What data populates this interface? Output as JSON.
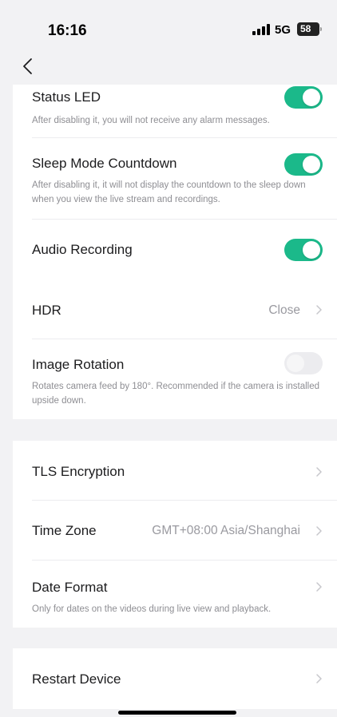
{
  "status_bar": {
    "time": "16:16",
    "network": "5G",
    "battery": "58"
  },
  "settings": {
    "status_led": {
      "title": "Status LED",
      "description": "After disabling it, you will not receive any alarm messages.",
      "enabled": true
    },
    "sleep_mode_countdown": {
      "title": "Sleep Mode Countdown",
      "description": "After disabling it, it will not display the countdown to the sleep down when you view the live stream and recordings.",
      "enabled": true
    },
    "audio_recording": {
      "title": "Audio Recording",
      "enabled": true
    },
    "hdr": {
      "title": "HDR",
      "value": "Close"
    },
    "image_rotation": {
      "title": "Image Rotation",
      "description": "Rotates camera feed by 180°. Recommended if the camera is installed upside down.",
      "enabled": false
    }
  },
  "system": {
    "tls_encryption": {
      "title": "TLS Encryption"
    },
    "time_zone": {
      "title": "Time Zone",
      "value": "GMT+08:00 Asia/Shanghai"
    },
    "date_format": {
      "title": "Date Format",
      "description": "Only for dates on the videos during live view and playback."
    }
  },
  "device": {
    "restart": {
      "title": "Restart Device"
    }
  },
  "colors": {
    "toggle_on": "#1bb98a",
    "toggle_off": "#ececef",
    "background": "#f2f2f4"
  }
}
